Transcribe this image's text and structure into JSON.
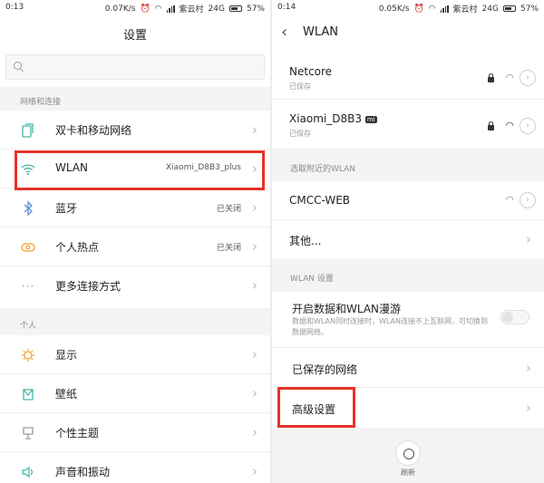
{
  "left": {
    "status": {
      "time": "0:13",
      "speed": "0.07K/s",
      "carrier": "紫云村",
      "network": "24G",
      "battery": "57%"
    },
    "title": "设置",
    "search": {
      "placeholder": ""
    },
    "section_connect": "网络和连接",
    "items": [
      {
        "label": "双卡和移动网络",
        "value": "",
        "icon": "dual-sim-icon"
      },
      {
        "label": "WLAN",
        "value": "Xiaomi_D8B3_plus",
        "icon": "wifi-icon"
      },
      {
        "label": "蓝牙",
        "value": "已关闭",
        "icon": "bluetooth-icon"
      },
      {
        "label": "个人热点",
        "value": "已关闭",
        "icon": "hotspot-icon"
      },
      {
        "label": "更多连接方式",
        "value": "",
        "icon": "more-dots-icon"
      }
    ],
    "section_personal": "个人",
    "personal_items": [
      {
        "label": "显示",
        "icon": "display-icon"
      },
      {
        "label": "壁纸",
        "icon": "wallpaper-icon"
      },
      {
        "label": "个性主题",
        "icon": "theme-icon"
      },
      {
        "label": "声音和振动",
        "icon": "sound-icon"
      }
    ]
  },
  "right": {
    "status": {
      "time": "0:14",
      "speed": "0.05K/s",
      "carrier": "紫云村",
      "network": "24G",
      "battery": "57%"
    },
    "title": "WLAN",
    "saved_networks": [
      {
        "name": "Netcore",
        "status": "已保存"
      },
      {
        "name": "Xiaomi_D8B3",
        "badge": "mi",
        "status": "已保存"
      }
    ],
    "section_nearby": "选取附近的WLAN",
    "nearby": [
      {
        "name": "CMCC-WEB"
      }
    ],
    "other_label": "其他...",
    "section_settings": "WLAN 设置",
    "roaming": {
      "title": "开启数据和WLAN漫游",
      "description": "数据和WLAN同时连接时，WLAN连接不上互联网，可切换到数据网络。"
    },
    "saved_network_label": "已保存的网络",
    "advanced_label": "高级设置",
    "refresh_label": "刷新"
  },
  "colors": {
    "highlight": "#e5332a",
    "accent": "#47b6a7"
  }
}
